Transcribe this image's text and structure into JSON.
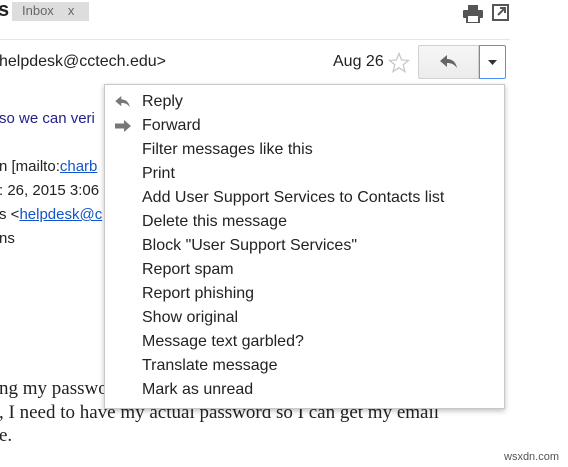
{
  "subject_fragment": "s",
  "inbox_tag": {
    "label": "Inbox",
    "close": "x"
  },
  "message_header": {
    "sender": "helpdesk@cctech.edu>",
    "date": "Aug 26"
  },
  "body": {
    "line_verify": "so we can veri",
    "line_from_prefix": "n [mailto:",
    "line_from_link": "charb",
    "line_sent": ": 26, 2015 3:06",
    "line_to_prefix": "s <",
    "line_to_link": "helpdesk@c",
    "line_ns": "ns",
    "line_password": "ng my passwo",
    "line_need": ", I need to have my actual password so I can get my email",
    "line_end": "e."
  },
  "menu": {
    "items": [
      {
        "label": "Reply",
        "icon": "reply-icon"
      },
      {
        "label": "Forward",
        "icon": "forward-icon"
      },
      {
        "label": "Filter messages like this"
      },
      {
        "label": "Print"
      },
      {
        "label": "Add User Support Services to Contacts list"
      },
      {
        "label": "Delete this message"
      },
      {
        "label": "Block \"User Support Services\""
      },
      {
        "label": "Report spam"
      },
      {
        "label": "Report phishing"
      },
      {
        "label": "Show original"
      },
      {
        "label": "Message text garbled?"
      },
      {
        "label": "Translate message"
      },
      {
        "label": "Mark as unread"
      }
    ]
  },
  "watermark": "wsxdn.com"
}
